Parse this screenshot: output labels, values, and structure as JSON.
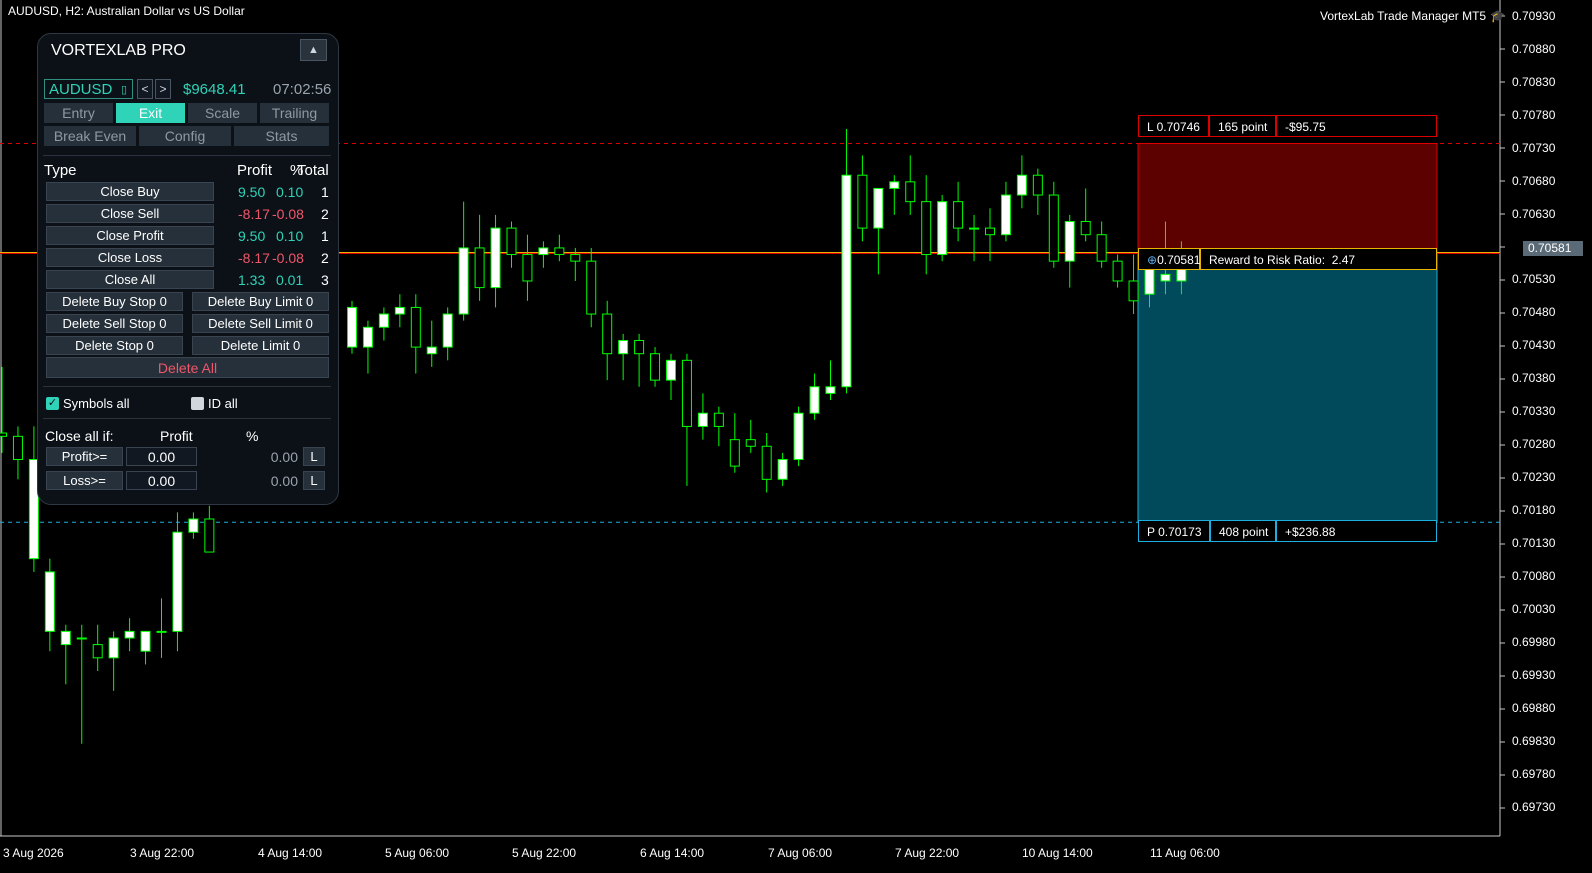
{
  "header": {
    "symbol_title": "AUDUSD, H2:  Australian Dollar vs US Dollar",
    "brand": "VortexLab Trade Manager MT5",
    "brand_icon": "graduation-cap-icon"
  },
  "colors": {
    "background": "#000000",
    "bull_candle": "#ffffff",
    "wick": "#00ff00",
    "stop_zone": "#5c0000",
    "profit_zone": "#004a5c",
    "accent": "#2fd3b7",
    "negative": "#f0566a"
  },
  "price_axis": [
    "0.70930",
    "0.70880",
    "0.70830",
    "0.70780",
    "0.70730",
    "0.70680",
    "0.70630",
    "0.70581",
    "0.70530",
    "0.70480",
    "0.70430",
    "0.70380",
    "0.70330",
    "0.70280",
    "0.70230",
    "0.70180",
    "0.70130",
    "0.70080",
    "0.70030",
    "0.69980",
    "0.69930",
    "0.69880",
    "0.69830",
    "0.69780",
    "0.69730"
  ],
  "current_price": "0.70581",
  "time_axis": [
    "3 Aug 2026",
    "3 Aug 22:00",
    "4 Aug 14:00",
    "5 Aug 06:00",
    "5 Aug 22:00",
    "6 Aug 14:00",
    "7 Aug 06:00",
    "7 Aug 22:00",
    "10 Aug 14:00",
    "11 Aug 06:00"
  ],
  "chart_data": {
    "type": "candlestick",
    "price_range": [
      0.697,
      0.7096
    ],
    "candles": [
      {
        "o": 0.70308,
        "h": 0.70408,
        "l": 0.70278,
        "c": 0.70303
      },
      {
        "o": 0.70303,
        "h": 0.70318,
        "l": 0.70238,
        "c": 0.70268
      },
      {
        "o": 0.70118,
        "h": 0.70318,
        "l": 0.70098,
        "c": 0.70268
      },
      {
        "o": 0.70008,
        "h": 0.70118,
        "l": 0.69978,
        "c": 0.70098
      },
      {
        "o": 0.69988,
        "h": 0.70018,
        "l": 0.69928,
        "c": 0.70008
      },
      {
        "o": 0.69998,
        "h": 0.70018,
        "l": 0.69838,
        "c": 0.69998
      },
      {
        "o": 0.69988,
        "h": 0.70018,
        "l": 0.69948,
        "c": 0.69968
      },
      {
        "o": 0.69968,
        "h": 0.70008,
        "l": 0.69918,
        "c": 0.69998
      },
      {
        "o": 0.69998,
        "h": 0.70028,
        "l": 0.69978,
        "c": 0.70008
      },
      {
        "o": 0.69978,
        "h": 0.70008,
        "l": 0.69958,
        "c": 0.70008
      },
      {
        "o": 0.70008,
        "h": 0.70058,
        "l": 0.69968,
        "c": 0.70008
      },
      {
        "o": 0.70008,
        "h": 0.70188,
        "l": 0.69978,
        "c": 0.70158
      },
      {
        "o": 0.70158,
        "h": 0.70188,
        "l": 0.70148,
        "c": 0.70178
      },
      {
        "o": 0.70178,
        "h": 0.70198,
        "l": 0.70148,
        "c": 0.70128
      }
    ],
    "candles_b": [
      {
        "o": 0.70438,
        "h": 0.70508,
        "l": 0.70428,
        "c": 0.70498
      },
      {
        "o": 0.70438,
        "h": 0.70478,
        "l": 0.70398,
        "c": 0.70468
      },
      {
        "o": 0.70468,
        "h": 0.70498,
        "l": 0.70448,
        "c": 0.70488
      },
      {
        "o": 0.70488,
        "h": 0.70518,
        "l": 0.70468,
        "c": 0.70498
      },
      {
        "o": 0.70498,
        "h": 0.70518,
        "l": 0.70398,
        "c": 0.70438
      },
      {
        "o": 0.70428,
        "h": 0.70478,
        "l": 0.70408,
        "c": 0.70438
      },
      {
        "o": 0.70438,
        "h": 0.70498,
        "l": 0.70418,
        "c": 0.70488
      },
      {
        "o": 0.70488,
        "h": 0.70658,
        "l": 0.70478,
        "c": 0.70588
      },
      {
        "o": 0.70588,
        "h": 0.70638,
        "l": 0.70508,
        "c": 0.70528
      },
      {
        "o": 0.70528,
        "h": 0.70638,
        "l": 0.70498,
        "c": 0.70618
      },
      {
        "o": 0.70618,
        "h": 0.70628,
        "l": 0.70558,
        "c": 0.70578
      },
      {
        "o": 0.70578,
        "h": 0.70608,
        "l": 0.70508,
        "c": 0.70538
      },
      {
        "o": 0.70578,
        "h": 0.70598,
        "l": 0.70558,
        "c": 0.70588
      },
      {
        "o": 0.70588,
        "h": 0.70608,
        "l": 0.70568,
        "c": 0.70578
      },
      {
        "o": 0.70578,
        "h": 0.70588,
        "l": 0.70538,
        "c": 0.70568
      },
      {
        "o": 0.70568,
        "h": 0.70588,
        "l": 0.70468,
        "c": 0.70488
      },
      {
        "o": 0.70488,
        "h": 0.70508,
        "l": 0.70388,
        "c": 0.70428
      },
      {
        "o": 0.70428,
        "h": 0.70458,
        "l": 0.70388,
        "c": 0.70448
      },
      {
        "o": 0.70448,
        "h": 0.70458,
        "l": 0.70378,
        "c": 0.70428
      },
      {
        "o": 0.70428,
        "h": 0.70438,
        "l": 0.70378,
        "c": 0.70388
      },
      {
        "o": 0.70388,
        "h": 0.70428,
        "l": 0.70358,
        "c": 0.70418
      },
      {
        "o": 0.70418,
        "h": 0.70428,
        "l": 0.70228,
        "c": 0.70318
      },
      {
        "o": 0.70318,
        "h": 0.70368,
        "l": 0.70298,
        "c": 0.70338
      },
      {
        "o": 0.70338,
        "h": 0.70348,
        "l": 0.70288,
        "c": 0.70318
      },
      {
        "o": 0.70298,
        "h": 0.70338,
        "l": 0.70248,
        "c": 0.70258
      },
      {
        "o": 0.70298,
        "h": 0.70328,
        "l": 0.70278,
        "c": 0.70288
      },
      {
        "o": 0.70288,
        "h": 0.70308,
        "l": 0.70218,
        "c": 0.70238
      },
      {
        "o": 0.70238,
        "h": 0.70278,
        "l": 0.70228,
        "c": 0.70268
      },
      {
        "o": 0.70268,
        "h": 0.70348,
        "l": 0.70258,
        "c": 0.70338
      },
      {
        "o": 0.70338,
        "h": 0.70398,
        "l": 0.70328,
        "c": 0.70378
      },
      {
        "o": 0.70368,
        "h": 0.70418,
        "l": 0.70358,
        "c": 0.70378
      },
      {
        "o": 0.70378,
        "h": 0.70768,
        "l": 0.70368,
        "c": 0.70698
      },
      {
        "o": 0.70698,
        "h": 0.70728,
        "l": 0.70598,
        "c": 0.70618
      },
      {
        "o": 0.70618,
        "h": 0.70678,
        "l": 0.70548,
        "c": 0.70678
      },
      {
        "o": 0.70678,
        "h": 0.70698,
        "l": 0.70638,
        "c": 0.70688
      },
      {
        "o": 0.70688,
        "h": 0.70728,
        "l": 0.70638,
        "c": 0.70658
      },
      {
        "o": 0.70658,
        "h": 0.70698,
        "l": 0.70548,
        "c": 0.70578
      },
      {
        "o": 0.70578,
        "h": 0.70668,
        "l": 0.70568,
        "c": 0.70658
      },
      {
        "o": 0.70658,
        "h": 0.70688,
        "l": 0.70598,
        "c": 0.70618
      },
      {
        "o": 0.70618,
        "h": 0.70638,
        "l": 0.70568,
        "c": 0.70618
      },
      {
        "o": 0.70618,
        "h": 0.70648,
        "l": 0.70568,
        "c": 0.70608
      },
      {
        "o": 0.70608,
        "h": 0.70688,
        "l": 0.70598,
        "c": 0.70668
      },
      {
        "o": 0.70668,
        "h": 0.70728,
        "l": 0.70648,
        "c": 0.70698
      },
      {
        "o": 0.70698,
        "h": 0.70708,
        "l": 0.70638,
        "c": 0.70668
      },
      {
        "o": 0.70668,
        "h": 0.70688,
        "l": 0.70558,
        "c": 0.70568
      },
      {
        "o": 0.70568,
        "h": 0.70638,
        "l": 0.70528,
        "c": 0.70628
      },
      {
        "o": 0.70628,
        "h": 0.70678,
        "l": 0.70598,
        "c": 0.70608
      },
      {
        "o": 0.70608,
        "h": 0.70628,
        "l": 0.70558,
        "c": 0.70568
      },
      {
        "o": 0.70568,
        "h": 0.70578,
        "l": 0.70528,
        "c": 0.70538
      },
      {
        "o": 0.70538,
        "h": 0.70578,
        "l": 0.70488,
        "c": 0.70508
      },
      {
        "o": 0.70518,
        "h": 0.70578,
        "l": 0.70498,
        "c": 0.70568
      },
      {
        "o": 0.70538,
        "h": 0.70628,
        "l": 0.70518,
        "c": 0.70548
      },
      {
        "o": 0.70538,
        "h": 0.70598,
        "l": 0.70518,
        "c": 0.70568
      }
    ],
    "entry_price": 0.70581,
    "stop_price": 0.70746,
    "take_profit_price": 0.70173
  },
  "risk_box": {
    "stop_label": "L 0.70746",
    "stop_points": "165 point",
    "stop_money": "-$95.75",
    "entry_label": "0.70581",
    "rr_label": "Reward to Risk Ratio:",
    "rr_value": "2.47",
    "tp_label": "P 0.70173",
    "tp_points": "408 point",
    "tp_money": "+$236.88"
  },
  "panel": {
    "title": "VORTEXLAB PRO",
    "collapse": "▲",
    "symbol": "AUDUSD",
    "symbol_dropdown": "▯",
    "prev": "<",
    "next": ">",
    "balance": "$9648.41",
    "clock": "07:02:56",
    "tabs_row1": [
      "Entry",
      "Exit",
      "Scale",
      "Trailing"
    ],
    "tabs_row2": [
      "Break Even",
      "Config",
      "Stats"
    ],
    "active_tab": "Exit",
    "table_headers": {
      "type": "Type",
      "profit": "Profit",
      "pct": "%",
      "total": "Total"
    },
    "rows": [
      {
        "label": "Close Buy",
        "profit": "9.50",
        "pct": "0.10",
        "total": "1",
        "sign": "pos"
      },
      {
        "label": "Close Sell",
        "profit": "-8.17",
        "pct": "-0.08",
        "total": "2",
        "sign": "neg"
      },
      {
        "label": "Close Profit",
        "profit": "9.50",
        "pct": "0.10",
        "total": "1",
        "sign": "pos"
      },
      {
        "label": "Close Loss",
        "profit": "-8.17",
        "pct": "-0.08",
        "total": "2",
        "sign": "neg"
      },
      {
        "label": "Close All",
        "profit": "1.33",
        "pct": "0.01",
        "total": "3",
        "sign": "pos"
      }
    ],
    "delete_buttons": [
      [
        "Delete Buy Stop  0",
        "Delete Buy Limit  0"
      ],
      [
        "Delete Sell Stop  0",
        "Delete Sell Limit  0"
      ],
      [
        "Delete Stop  0",
        "Delete Limit  0"
      ]
    ],
    "delete_all": "Delete All",
    "symbols_all": {
      "label": "Symbols all",
      "checked": true
    },
    "id_all": {
      "label": "ID all",
      "checked": false
    },
    "close_all_if": "Close all if:",
    "close_profit_header": "Profit",
    "close_pct_header": "%",
    "profit_rule": {
      "label": "Profit>=",
      "value": "0.00",
      "pct": "0.00",
      "lock": "L"
    },
    "loss_rule": {
      "label": "Loss>=",
      "value": "0.00",
      "pct": "0.00",
      "lock": "L"
    }
  }
}
